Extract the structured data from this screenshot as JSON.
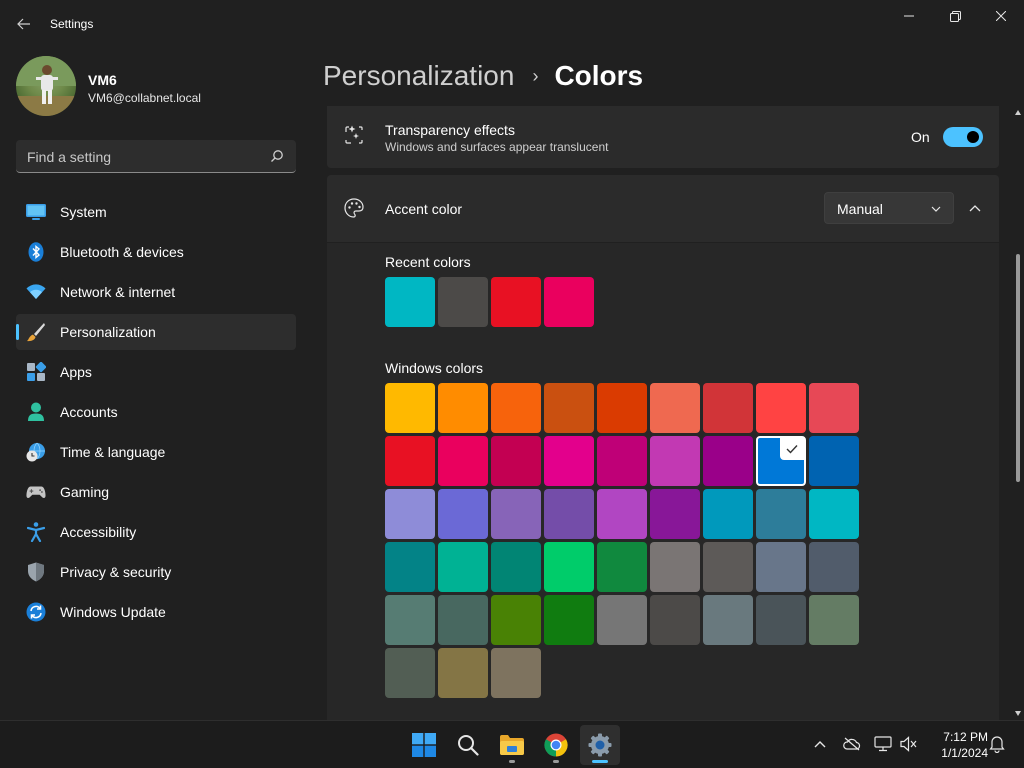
{
  "window": {
    "app_title": "Settings",
    "back_icon": "arrow-left-icon",
    "controls": [
      "minimize-icon",
      "restore-icon",
      "close-icon"
    ]
  },
  "profile": {
    "name": "VM6",
    "email": "VM6@collabnet.local"
  },
  "search": {
    "placeholder": "Find a setting",
    "icon": "search-icon"
  },
  "sidebar": {
    "items": [
      {
        "label": "System",
        "icon": "monitor-icon",
        "active": false
      },
      {
        "label": "Bluetooth & devices",
        "icon": "bluetooth-icon",
        "active": false
      },
      {
        "label": "Network & internet",
        "icon": "wifi-icon",
        "active": false
      },
      {
        "label": "Personalization",
        "icon": "paintbrush-icon",
        "active": true
      },
      {
        "label": "Apps",
        "icon": "apps-icon",
        "active": false
      },
      {
        "label": "Accounts",
        "icon": "person-icon",
        "active": false
      },
      {
        "label": "Time & language",
        "icon": "globe-clock-icon",
        "active": false
      },
      {
        "label": "Gaming",
        "icon": "gamepad-icon",
        "active": false
      },
      {
        "label": "Accessibility",
        "icon": "accessibility-icon",
        "active": false
      },
      {
        "label": "Privacy & security",
        "icon": "shield-icon",
        "active": false
      },
      {
        "label": "Windows Update",
        "icon": "update-icon",
        "active": false
      }
    ]
  },
  "breadcrumb": {
    "parent": "Personalization",
    "separator": "›",
    "current": "Colors"
  },
  "transparency": {
    "title": "Transparency effects",
    "subtitle": "Windows and surfaces appear translucent",
    "state_label": "On",
    "enabled": true
  },
  "accent": {
    "title": "Accent color",
    "dropdown_value": "Manual",
    "expanded": true
  },
  "recent_colors": {
    "label": "Recent colors",
    "colors": [
      "#00b7c3",
      "#4c4a48",
      "#e81123",
      "#ea005e"
    ]
  },
  "windows_colors": {
    "label": "Windows colors",
    "selected": "#0078d7",
    "rows": [
      [
        "#ffb900",
        "#ff8c00",
        "#f7630c",
        "#ca5010",
        "#da3b01",
        "#ef6950",
        "#d13438",
        "#ff4343",
        "#e74856"
      ],
      [
        "#e81123",
        "#ea005e",
        "#c30052",
        "#e3008c",
        "#bf0077",
        "#c239b3",
        "#9a0089",
        "#0078d7",
        "#0063b1"
      ],
      [
        "#8e8cd8",
        "#6b69d6",
        "#8764b8",
        "#744da9",
        "#b146c2",
        "#881798",
        "#0099bc",
        "#2d7d9a",
        "#00b7c3"
      ],
      [
        "#038387",
        "#00b294",
        "#018574",
        "#00cc6a",
        "#10893e",
        "#7a7574",
        "#5d5a58",
        "#68768a",
        "#515c6b"
      ],
      [
        "#567c73",
        "#486860",
        "#498205",
        "#107c10",
        "#767676",
        "#4c4a48",
        "#69797e",
        "#4a5459",
        "#647c64"
      ],
      [
        "#525e54",
        "#847545",
        "#7e735f"
      ]
    ]
  },
  "taskbar": {
    "apps": [
      {
        "name": "start-button",
        "icon": "windows-logo-icon",
        "running": false,
        "active": false
      },
      {
        "name": "search-button",
        "icon": "search-icon",
        "running": false,
        "active": false
      },
      {
        "name": "file-explorer-button",
        "icon": "folder-icon",
        "running": true,
        "active": false
      },
      {
        "name": "chrome-button",
        "icon": "chrome-icon",
        "running": true,
        "active": false
      },
      {
        "name": "settings-button",
        "icon": "gear-icon",
        "running": true,
        "active": true
      }
    ],
    "tray": [
      "chevron-up-icon",
      "onedrive-offline-icon",
      "network-icon",
      "volume-muted-icon"
    ],
    "time": "7:12 PM",
    "date": "1/1/2024",
    "notification_icon": "bell-icon"
  },
  "colors": {
    "accent": "#4cc2ff",
    "background": "#202020",
    "card": "#2b2b2b"
  }
}
